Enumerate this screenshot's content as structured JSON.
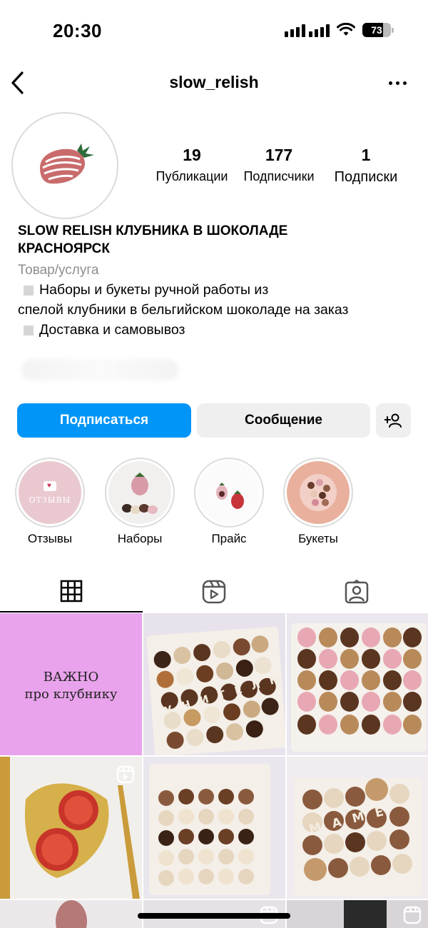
{
  "status": {
    "time": "20:30",
    "battery": "73",
    "battery_level": 0.73
  },
  "header": {
    "username": "slow_relish"
  },
  "profile": {
    "stats": [
      {
        "num": "19",
        "label": "Публикации"
      },
      {
        "num": "177",
        "label": "Подписчики"
      },
      {
        "num": "1",
        "label": "Подписки"
      }
    ],
    "name_line1": "SLOW RELISH КЛУБНИКА В ШОКОЛАДЕ",
    "name_line2": "КРАСНОЯРСК",
    "category": "Товар/услуга",
    "bio_line1": "Наборы и букеты ручной работы из",
    "bio_line2": "спелой клубники в бельгийском шоколаде на заказ",
    "bio_line3": "Доставка и самовывоз"
  },
  "actions": {
    "follow": "Подписаться",
    "message": "Сообщение"
  },
  "highlights": [
    {
      "label": "Отзывы",
      "inner_text": "ОТЗЫВЫ"
    },
    {
      "label": "Наборы"
    },
    {
      "label": "Прайс"
    },
    {
      "label": "Букеты"
    }
  ],
  "tabs": [
    "grid-icon",
    "reels-icon",
    "tagged-icon"
  ],
  "posts": {
    "first_text_line1": "ВАЖНО",
    "first_text_line2": "про клубнику",
    "box_letters_1": "УЧИТЕЛЮ",
    "box_letters_2": "МАМЕ"
  },
  "colors": {
    "accent": "#0095f6",
    "button_gray": "#efefef",
    "muted_text": "#8e8e8e",
    "post_pink": "#e9a3ec"
  }
}
